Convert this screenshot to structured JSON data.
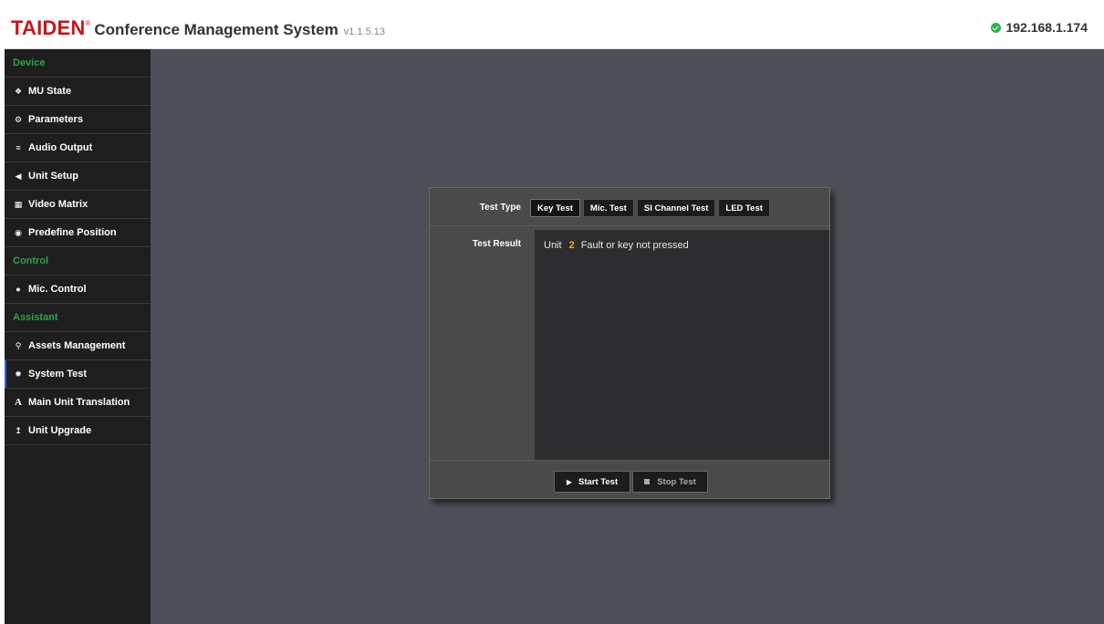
{
  "header": {
    "brand_name": "TAIDEN",
    "brand_reg": "®",
    "title": "Conference Management System",
    "version": "v1.1.5.13",
    "ip": "192.168.1.174",
    "ip_status_color": "#2db34a"
  },
  "sidebar": {
    "groups": [
      {
        "label": "Device"
      },
      {
        "label": "Control"
      },
      {
        "label": "Assistant"
      }
    ],
    "items": [
      {
        "label": "MU State",
        "icon": "info-icon"
      },
      {
        "label": "Parameters",
        "icon": "gears-icon"
      },
      {
        "label": "Audio Output",
        "icon": "sliders-icon"
      },
      {
        "label": "Unit Setup",
        "icon": "speaker-icon"
      },
      {
        "label": "Video Matrix",
        "icon": "grid-icon"
      },
      {
        "label": "Predefine Position",
        "icon": "camera-icon"
      },
      {
        "label": "Mic. Control",
        "icon": "microphone-icon"
      },
      {
        "label": "Assets Management",
        "icon": "map-marker-icon"
      },
      {
        "label": "System Test",
        "icon": "bug-icon"
      },
      {
        "label": "Main Unit Translation",
        "icon": "font-icon"
      },
      {
        "label": "Unit Upgrade",
        "icon": "upload-icon"
      }
    ],
    "active_item": "System Test"
  },
  "panel": {
    "test_type_label": "Test Type",
    "tabs": [
      "Key Test",
      "Mic. Test",
      "SI Channel Test",
      "LED Test"
    ],
    "test_result_label": "Test Result",
    "result": {
      "prefix": "Unit",
      "unit_number": "2",
      "message": "Fault or key not pressed"
    },
    "start_label": "Start Test",
    "stop_label": "Stop Test"
  }
}
